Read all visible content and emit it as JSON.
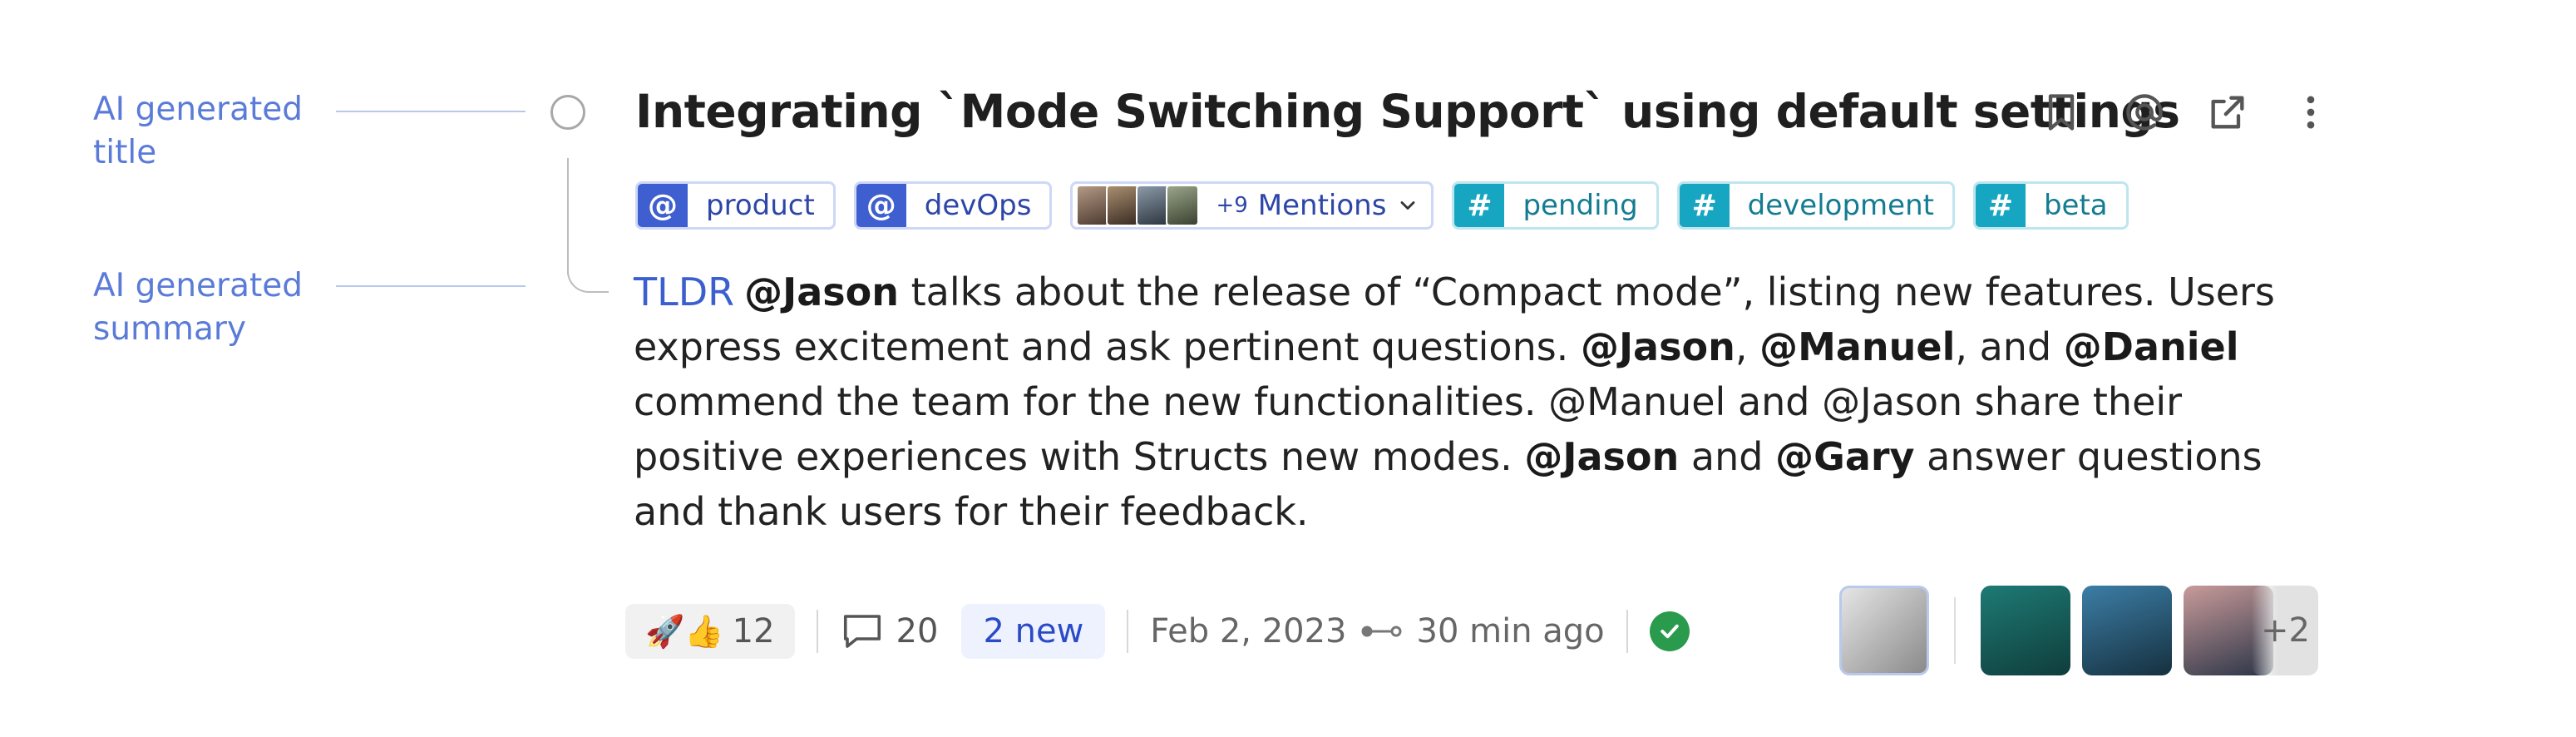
{
  "annotations": {
    "title_label_line1": "AI generated",
    "title_label_line2": "title",
    "summary_label_line1": "AI generated",
    "summary_label_line2": "summary"
  },
  "post": {
    "title": "Integrating `Mode Switching Support` using default settings",
    "tags": [
      {
        "type": "mention",
        "label": "product"
      },
      {
        "type": "mention",
        "label": "devOps"
      },
      {
        "type": "hashtag",
        "label": "pending"
      },
      {
        "type": "hashtag",
        "label": "development"
      },
      {
        "type": "hashtag",
        "label": "beta"
      }
    ],
    "mentions": {
      "more": "+9",
      "label": "Mentions"
    },
    "summary": {
      "tldr": "TLDR",
      "s1": "@Jason",
      "s2": " talks about the release of “Compact mode”, listing new features. Users express excitement and ask pertinent questions. ",
      "s3": "@Jason",
      "s4": ", ",
      "s5": "@Manuel",
      "s6": ", and ",
      "s7": "@Daniel",
      "s8": " commend the team for the new functionalities. @Manuel and @Jason share their positive experiences with Structs new modes. ",
      "s9": "@Jason",
      "s10": " and ",
      "s11": "@Gary",
      "s12": " answer questions and thank users for their feedback."
    }
  },
  "footer": {
    "reactions_emoji": "🚀👍",
    "reactions_count": "12",
    "comments_count": "20",
    "new_label": "2 new",
    "date": "Feb 2, 2023",
    "time_ago": "30 min ago",
    "participants_more": "+2"
  },
  "colors": {
    "accent": "#3f5fd0",
    "hashtag": "#16a6c2",
    "resolved": "#2a9a4c"
  },
  "icons": [
    "bookmark-icon",
    "mention-icon",
    "external-link-icon",
    "more-vertical-icon",
    "chevron-down-icon",
    "comment-icon",
    "thread-link-icon",
    "check-icon"
  ]
}
